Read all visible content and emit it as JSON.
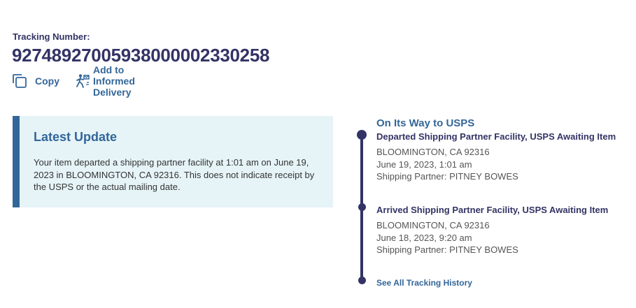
{
  "tracking": {
    "label": "Tracking Number:",
    "number": "92748927005938000002330258"
  },
  "actions": {
    "copy_label": "Copy",
    "informed_delivery_label": "Add to Informed Delivery"
  },
  "latest_update": {
    "heading": "Latest Update",
    "text": "Your item departed a shipping partner facility at 1:01 am on June 19, 2023 in BLOOMINGTON, CA 92316. This does not indicate receipt by the USPS or the actual mailing date."
  },
  "timeline": {
    "status": "On Its Way to USPS",
    "events": [
      {
        "title": "Departed Shipping Partner Facility, USPS Awaiting Item",
        "location": "BLOOMINGTON, CA 92316",
        "datetime": "June 19, 2023, 1:01 am",
        "partner": "Shipping Partner: PITNEY BOWES"
      },
      {
        "title": "Arrived Shipping Partner Facility, USPS Awaiting Item",
        "location": "BLOOMINGTON, CA 92316",
        "datetime": "June 18, 2023, 9:20 am",
        "partner": "Shipping Partner: PITNEY BOWES"
      }
    ],
    "history_link": "See All Tracking History"
  },
  "colors": {
    "navy": "#333366",
    "blue": "#336699",
    "panel_bg": "#e6f4f8"
  }
}
